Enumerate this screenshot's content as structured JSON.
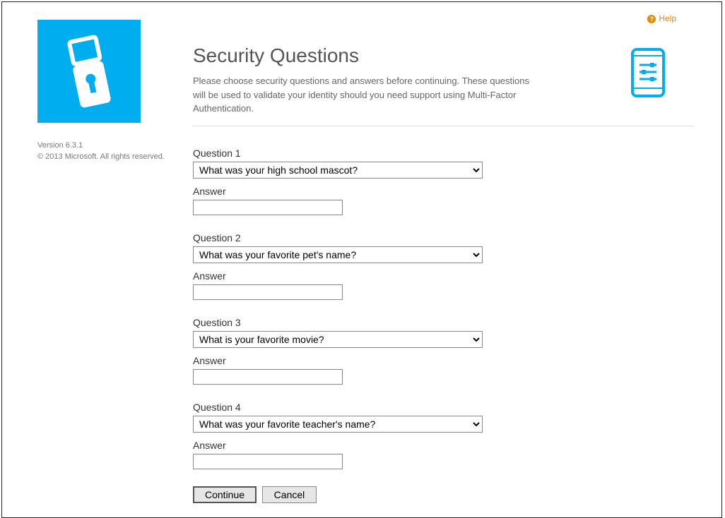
{
  "sidebar": {
    "version_text": "Version 6.3.1",
    "copyright_text": "© 2013 Microsoft. All rights reserved."
  },
  "help_label": "Help",
  "header": {
    "title": "Security Questions",
    "subtitle": "Please choose security questions and answers before continuing. These questions will be used to validate your identity should you need support using Multi-Factor Authentication."
  },
  "questions": [
    {
      "label": "Question 1",
      "answer_label": "Answer",
      "selected": "What was your high school mascot?",
      "value": ""
    },
    {
      "label": "Question 2",
      "answer_label": "Answer",
      "selected": "What was your favorite pet's name?",
      "value": ""
    },
    {
      "label": "Question 3",
      "answer_label": "Answer",
      "selected": "What is your favorite movie?",
      "value": ""
    },
    {
      "label": "Question 4",
      "answer_label": "Answer",
      "selected": "What was your favorite teacher's name?",
      "value": ""
    }
  ],
  "buttons": {
    "continue_label": "Continue",
    "cancel_label": "Cancel"
  }
}
